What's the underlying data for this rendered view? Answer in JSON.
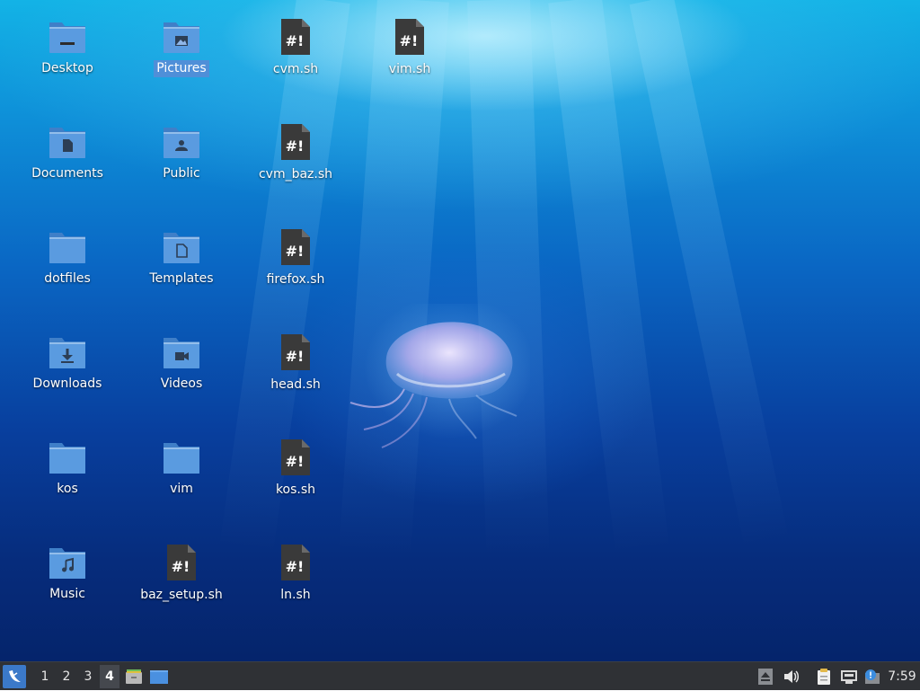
{
  "desktop": {
    "icons": [
      {
        "label": "Desktop",
        "kind": "folder-desktop",
        "icon": "desktop-folder-icon"
      },
      {
        "label": "Pictures",
        "kind": "folder-pictures",
        "icon": "pictures-folder-icon",
        "selected": true
      },
      {
        "label": "cvm.sh",
        "kind": "script",
        "icon": "shell-script-icon"
      },
      {
        "label": "vim.sh",
        "kind": "script",
        "icon": "shell-script-icon"
      },
      {
        "label": "Documents",
        "kind": "folder-documents",
        "icon": "documents-folder-icon"
      },
      {
        "label": "Public",
        "kind": "folder-public",
        "icon": "public-folder-icon"
      },
      {
        "label": "cvm_baz.sh",
        "kind": "script",
        "icon": "shell-script-icon"
      },
      {
        "label": "dotfiles",
        "kind": "folder",
        "icon": "folder-icon"
      },
      {
        "label": "Templates",
        "kind": "folder-templates",
        "icon": "templates-folder-icon"
      },
      {
        "label": "firefox.sh",
        "kind": "script",
        "icon": "shell-script-icon"
      },
      {
        "label": "Downloads",
        "kind": "folder-downloads",
        "icon": "downloads-folder-icon"
      },
      {
        "label": "Videos",
        "kind": "folder-videos",
        "icon": "videos-folder-icon"
      },
      {
        "label": "head.sh",
        "kind": "script",
        "icon": "shell-script-icon"
      },
      {
        "label": "kos",
        "kind": "folder",
        "icon": "folder-icon"
      },
      {
        "label": "vim",
        "kind": "folder",
        "icon": "folder-icon"
      },
      {
        "label": "kos.sh",
        "kind": "script",
        "icon": "shell-script-icon"
      },
      {
        "label": "Music",
        "kind": "folder-music",
        "icon": "music-folder-icon"
      },
      {
        "label": "baz_setup.sh",
        "kind": "script",
        "icon": "shell-script-icon"
      },
      {
        "label": "ln.sh",
        "kind": "script",
        "icon": "shell-script-icon"
      }
    ]
  },
  "taskbar": {
    "start_icon": "start-menu-icon",
    "workspaces": [
      "1",
      "2",
      "3",
      "4"
    ],
    "active_workspace": "4",
    "launchers": [
      {
        "name": "file-manager-launcher",
        "icon": "file-manager-icon"
      },
      {
        "name": "show-desktop-button",
        "icon": "show-desktop-icon"
      }
    ],
    "tray": [
      {
        "name": "eject-tray",
        "icon": "eject-icon"
      },
      {
        "name": "volume-tray",
        "icon": "volume-icon"
      },
      {
        "name": "clipboard-tray",
        "icon": "clipboard-icon"
      },
      {
        "name": "network-tray",
        "icon": "network-wired-icon"
      },
      {
        "name": "updates-tray",
        "icon": "update-notifier-icon"
      }
    ],
    "clock": "7:59"
  },
  "colors": {
    "folder": "#5a9be0",
    "folder_tab": "#3f7fc8",
    "script": "#3a3a3a",
    "selection": "#4f8fd8",
    "taskbar": "#2f3135"
  }
}
